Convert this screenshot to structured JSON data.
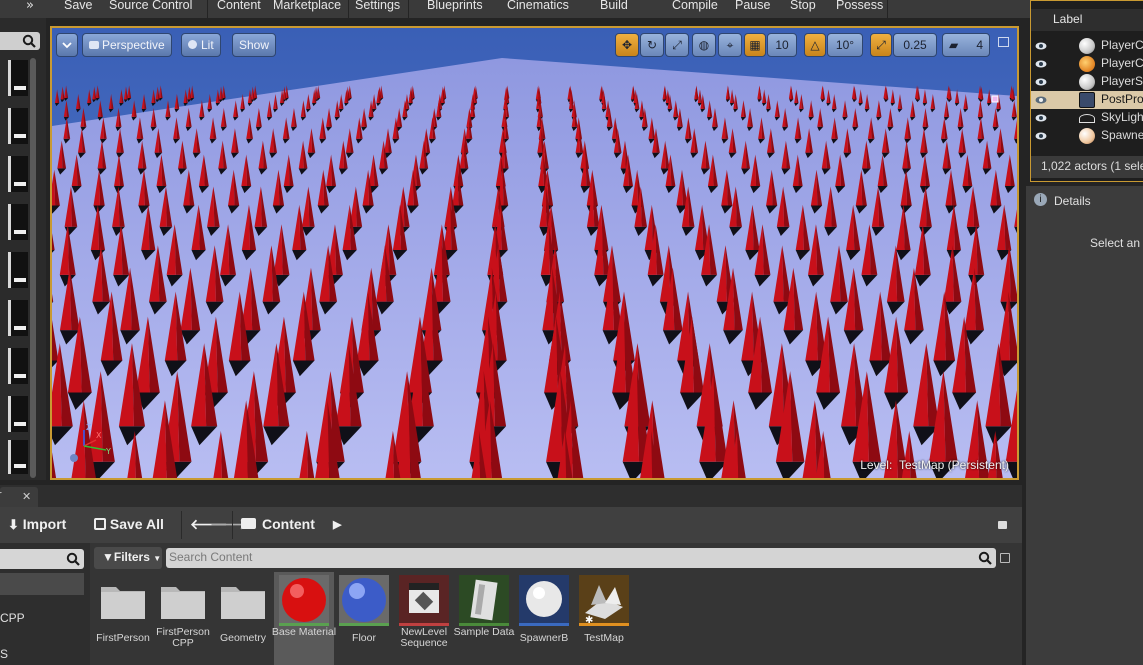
{
  "toolbar": {
    "items": [
      "Save",
      "Source Control",
      "Content",
      "Marketplace",
      "Settings",
      "Blueprints",
      "Cinematics",
      "Build",
      "Compile",
      "Pause",
      "Stop",
      "Possess"
    ]
  },
  "viewport": {
    "view_mode": "Perspective",
    "lighting_mode": "Lit",
    "show_label": "Show",
    "grid_snap": "10",
    "rotation_snap": "10°",
    "scale_snap": "0.25",
    "camera_speed": "4",
    "level_prefix": "Level:",
    "level_name": "TestMap (Persistent)",
    "colors": {
      "cone": "#c8101a",
      "floor": "#9aa3e6",
      "sky": "#3f66b8",
      "border": "#c99a32"
    }
  },
  "outliner": {
    "column_label": "Label",
    "rows": [
      {
        "label": "PlayerC",
        "selected": false,
        "icon": "sphere-icon"
      },
      {
        "label": "PlayerC",
        "selected": false,
        "icon": "player-start-icon"
      },
      {
        "label": "PlayerS",
        "selected": false,
        "icon": "sphere-icon"
      },
      {
        "label": "PostPro",
        "selected": true,
        "icon": "postprocess-icon"
      },
      {
        "label": "SkyLigh",
        "selected": false,
        "icon": "skylight-icon"
      },
      {
        "label": "Spawne",
        "selected": false,
        "icon": "sphere-icon"
      }
    ],
    "status": "1,022 actors (1 sele"
  },
  "details": {
    "tab_label": "Details",
    "empty_message": "Select an"
  },
  "content_browser": {
    "tab_fragment": "r",
    "import_label": "Import",
    "save_all_label": "Save All",
    "path_label": "Content",
    "filters_label": "Filters",
    "search_placeholder": "Search Content",
    "tree_items": [
      "CPP",
      "S"
    ],
    "assets": [
      {
        "name": "FirstPerson",
        "kind": "folder"
      },
      {
        "name": "FirstPerson CPP",
        "kind": "folder"
      },
      {
        "name": "Geometry",
        "kind": "folder"
      },
      {
        "name": "Base Material",
        "kind": "material",
        "selected": true
      },
      {
        "name": "Floor",
        "kind": "material"
      },
      {
        "name": "NewLevel Sequence",
        "kind": "sequence"
      },
      {
        "name": "Sample Data",
        "kind": "data"
      },
      {
        "name": "SpawnerB",
        "kind": "blueprint"
      },
      {
        "name": "TestMap",
        "kind": "map"
      }
    ]
  }
}
